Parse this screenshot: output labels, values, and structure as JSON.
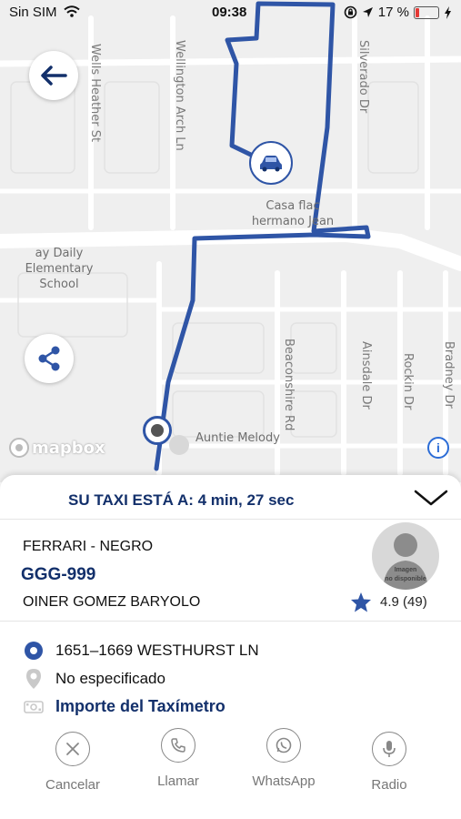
{
  "status_bar": {
    "carrier": "Sin SIM",
    "time": "09:38",
    "battery": "17 %"
  },
  "map": {
    "streets": [
      "Wells Heather St",
      "Wellington Arch Ln",
      "Silverado Dr",
      "Beaconshire Rd",
      "Ainsdale Dr",
      "Rockin Dr",
      "Bradney Dr"
    ],
    "poi_school": [
      "ay Daily Elementary",
      "School"
    ],
    "poi_casa": [
      "Casa flac",
      "hermano Jean"
    ],
    "poi_auntie": "Auntie Melody",
    "attribution": "mapbox",
    "info": "i"
  },
  "sheet": {
    "eta": "SU TAXI ESTÁ A: 4 min, 27 sec",
    "car_model": "FERRARI - NEGRO",
    "plate": "GGG-999",
    "driver_name": "OINER GOMEZ BARYOLO",
    "photo_caption": [
      "Imagen",
      "no disponible"
    ],
    "rating": "4.9 (49)",
    "pickup_address": "1651–1669 WESTHURST LN",
    "destination": "No especificado",
    "fare": "Importe del Taxímetro",
    "actions": {
      "cancel": "Cancelar",
      "call": "Llamar",
      "whatsapp": "WhatsApp",
      "radio": "Radio"
    }
  },
  "colors": {
    "brand_navy": "#13306b",
    "route_blue": "#2f55a6",
    "map_bg": "#efefef",
    "battery_low": "#e53935"
  }
}
